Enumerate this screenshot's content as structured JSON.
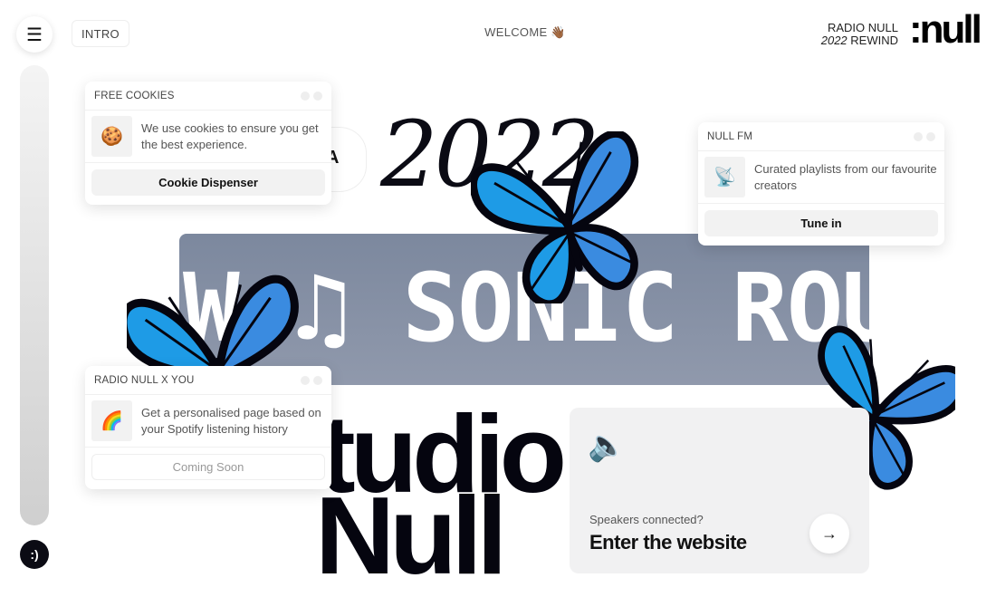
{
  "nav": {
    "menu_icon": "hamburger-icon",
    "intro_label": "INTRO",
    "welcome": "WELCOME 👋🏾",
    "smiley": ":)"
  },
  "brand": {
    "line1": "RADIO NULL",
    "line2_year": "2022",
    "line2_rest": "REWIND",
    "logo": ":null"
  },
  "hero": {
    "year": "2022",
    "marquee": "W ♫ SONIC ROU",
    "cloud_letter": "A",
    "title_line1": "tudio",
    "title_line2": "Null"
  },
  "cards": [
    {
      "title": "FREE COOKIES",
      "icon": "🍪",
      "text": "We use cookies to ensure you get the best experience.",
      "button": "Cookie Dispenser"
    },
    {
      "title": "NULL FM",
      "icon": "📡",
      "text": "Curated playlists from our favourite creators",
      "button": "Tune in"
    },
    {
      "title": "RADIO NULL X YOU",
      "icon": "🌈",
      "text": "Get a personalised page based on your Spotify listening history",
      "button": "Coming Soon"
    }
  ],
  "enter": {
    "icon": "🔈",
    "question": "Speakers connected?",
    "title": "Enter the website",
    "arrow": "→"
  },
  "colors": {
    "banner": "#7e8aa0",
    "butterfly": "#1e9be6",
    "dark": "#0b0b14"
  }
}
